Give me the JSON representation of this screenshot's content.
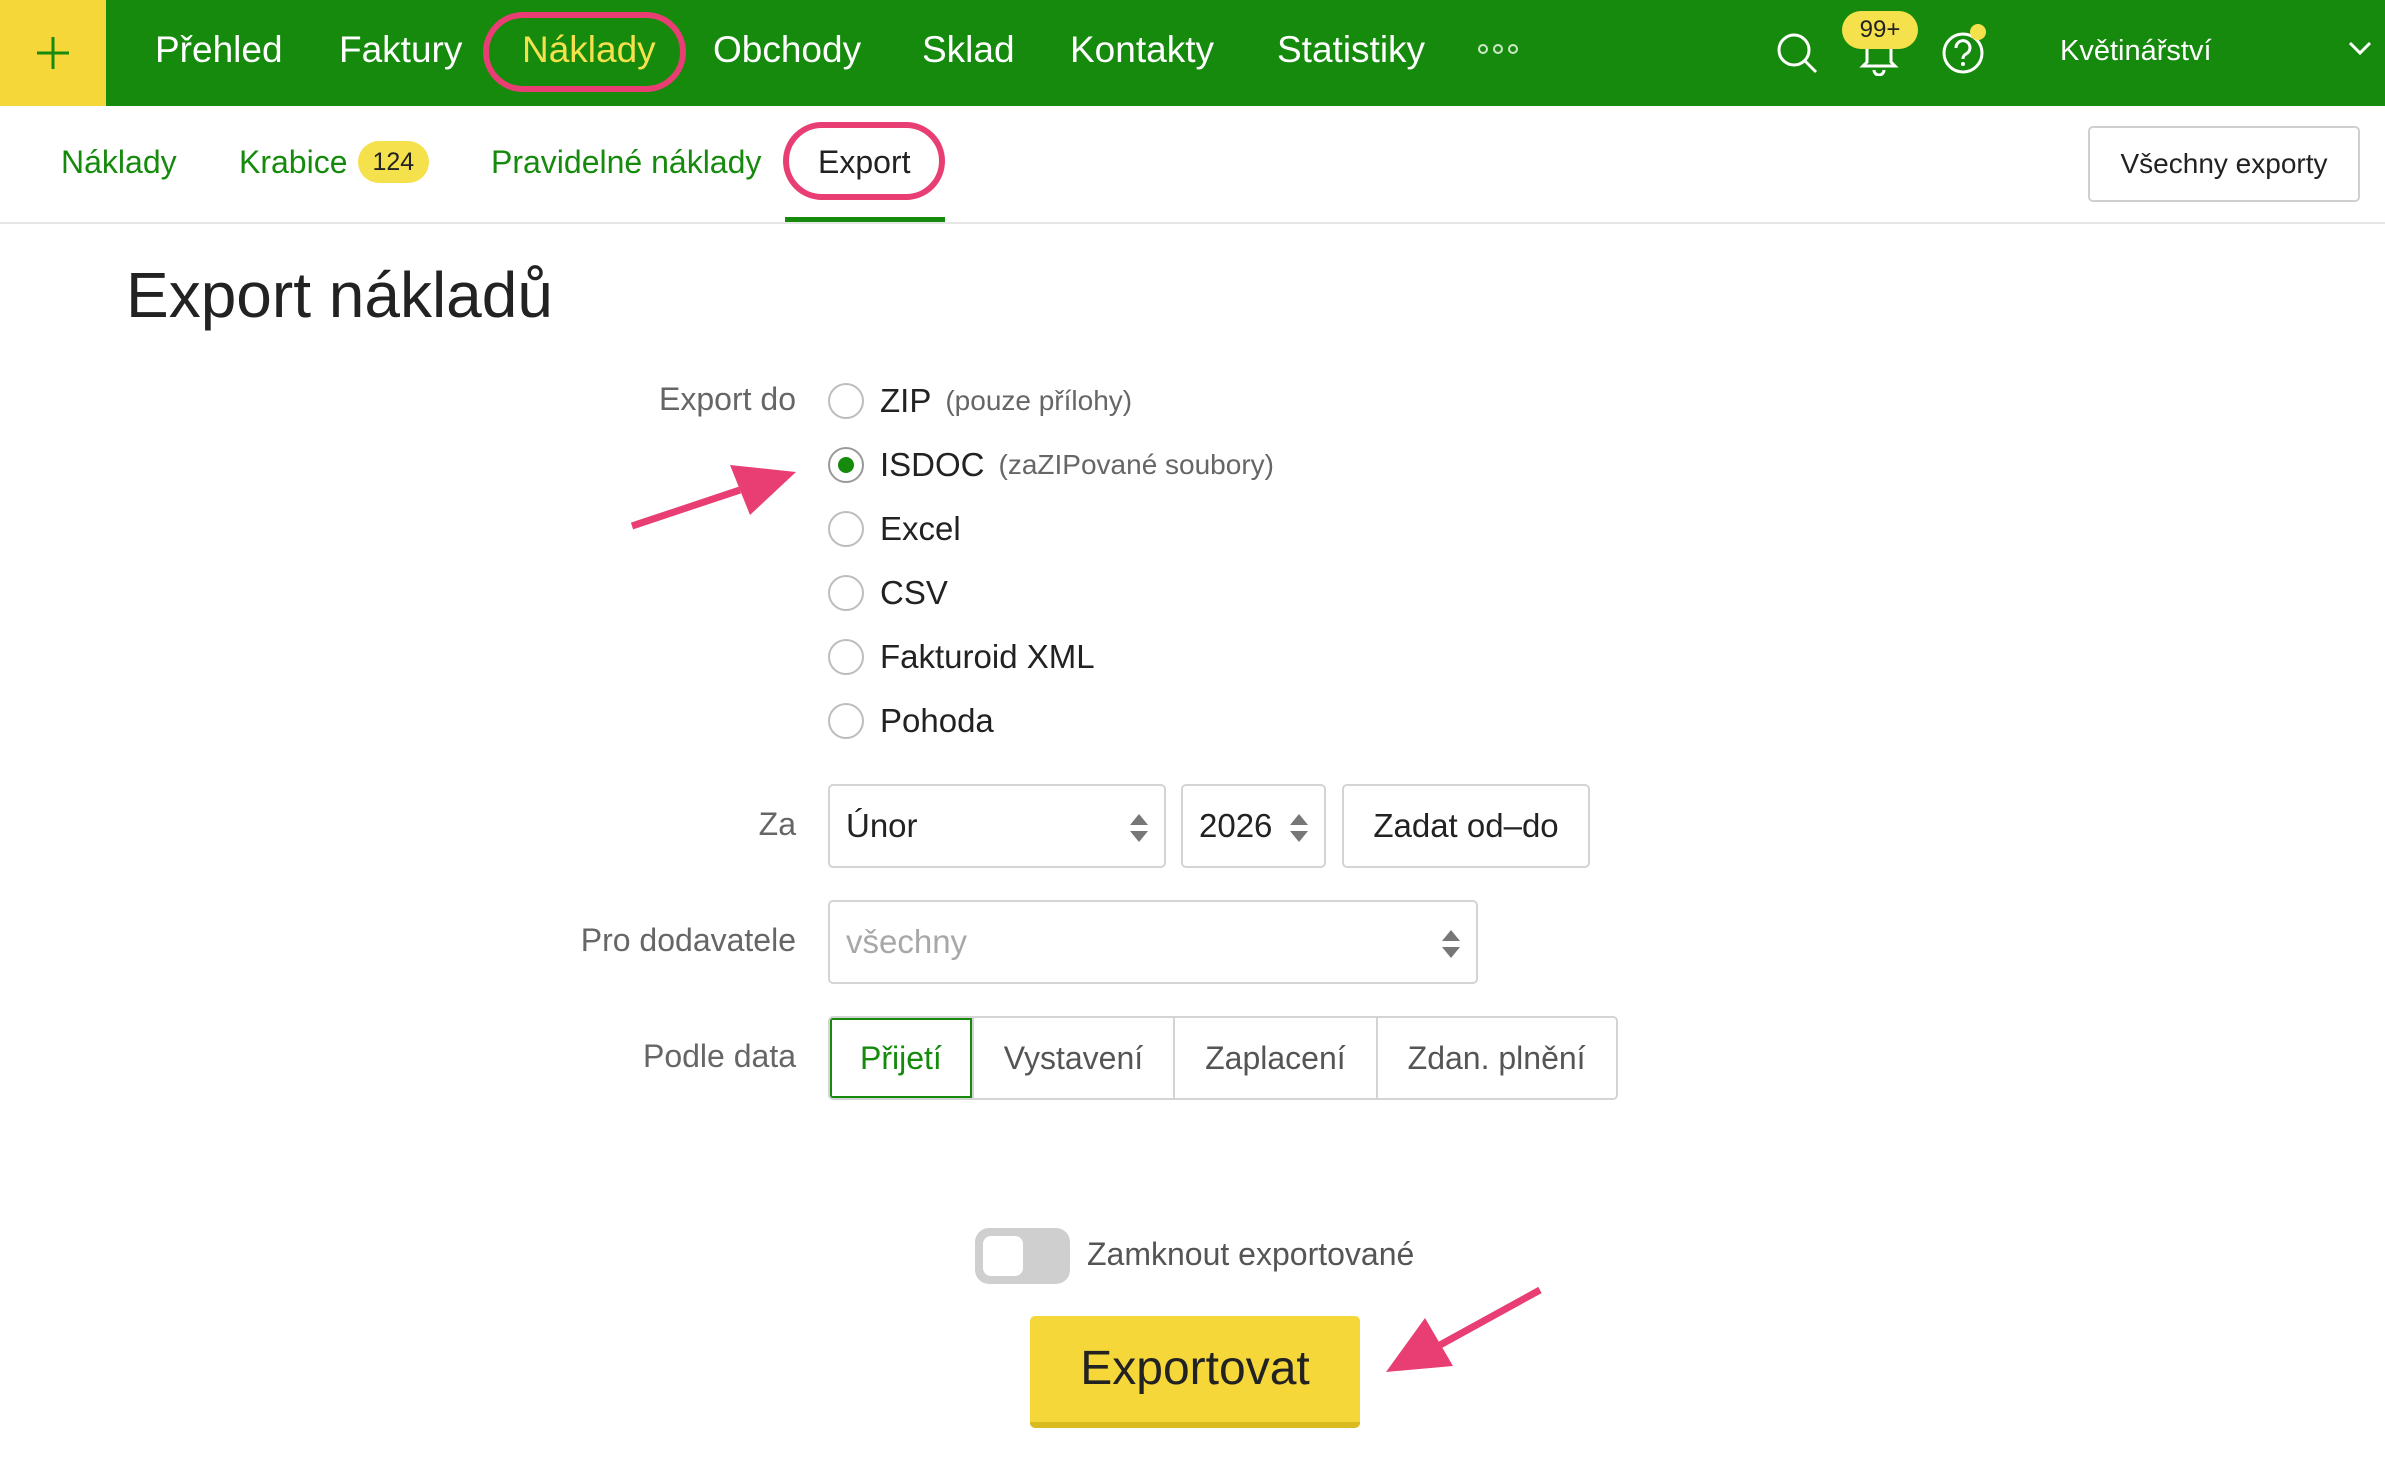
{
  "colors": {
    "brand_green": "#158a0c",
    "accent_yellow": "#f5d73a",
    "annotation_pink": "#e83e74"
  },
  "topnav": {
    "add_icon": "plus-icon",
    "items": [
      "Přehled",
      "Faktury",
      "Náklady",
      "Obchody",
      "Sklad",
      "Kontakty",
      "Statistiky"
    ],
    "active_item": "Náklady",
    "more_icon": "more-dots-icon",
    "search_icon": "search-icon",
    "notifications_icon": "bell-icon",
    "notifications_badge": "99+",
    "help_icon": "help-icon",
    "account_name": "Květinářství",
    "account_chevron_icon": "chevron-down-icon"
  },
  "subnav": {
    "items": [
      "Náklady",
      "Krabice",
      "Pravidelné náklady",
      "Export"
    ],
    "inbox_count": "124",
    "active_item": "Export",
    "all_exports_label": "Všechny exporty"
  },
  "main": {
    "title": "Export nákladů",
    "export_to": {
      "label": "Export do",
      "options": [
        {
          "label": "ZIP",
          "note": "(pouze přílohy)",
          "checked": false
        },
        {
          "label": "ISDOC",
          "note": "(zaZIPované soubory)",
          "checked": true
        },
        {
          "label": "Excel",
          "note": "",
          "checked": false
        },
        {
          "label": "CSV",
          "note": "",
          "checked": false
        },
        {
          "label": "Fakturoid XML",
          "note": "",
          "checked": false
        },
        {
          "label": "Pohoda",
          "note": "",
          "checked": false
        }
      ]
    },
    "period": {
      "label": "Za",
      "month": "Únor",
      "year": "2026",
      "range_button": "Zadat od–do"
    },
    "supplier": {
      "label": "Pro dodavatele",
      "placeholder": "všechny"
    },
    "date_basis": {
      "label": "Podle data",
      "options": [
        "Přijetí",
        "Vystavení",
        "Zaplacení",
        "Zdan. plnění"
      ],
      "active": "Přijetí"
    },
    "lock_toggle": {
      "label": "Zamknout exportované",
      "on": false
    },
    "export_button": "Exportovat"
  }
}
